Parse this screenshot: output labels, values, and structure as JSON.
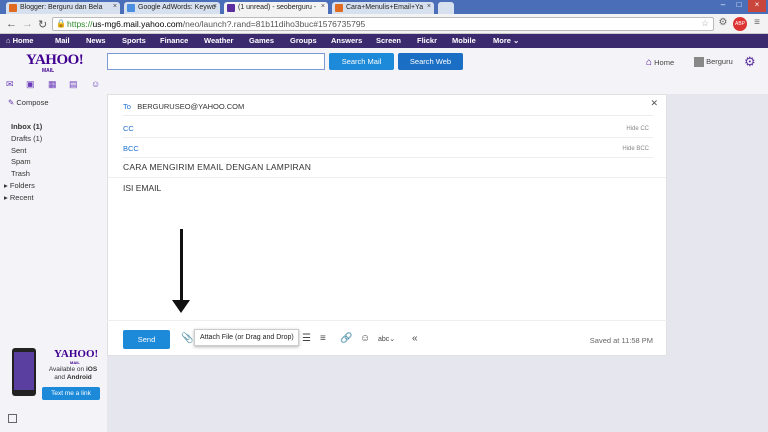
{
  "browser": {
    "tabs": [
      {
        "label": "Blogger: Berguru dan Bela",
        "fav_color": "#e06a1f",
        "active": false
      },
      {
        "label": "Google AdWords: Keywo",
        "fav_color": "#4a8fe0",
        "active": false
      },
      {
        "label": "(1 unread) - seoberguru -",
        "fav_color": "#5b2ea0",
        "active": true
      },
      {
        "label": "Cara+Menulis+Email+Ya",
        "fav_color": "#e06a1f",
        "active": false
      }
    ],
    "url_https": "https://",
    "url_domain": "us-mg6.mail.yahoo.com",
    "url_path": "/neo/launch?.rand=81b11diho3buc#1576735795"
  },
  "yahoo_nav": [
    "Home",
    "Mail",
    "News",
    "Sports",
    "Finance",
    "Weather",
    "Games",
    "Groups",
    "Answers",
    "Screen",
    "Flickr",
    "Mobile",
    "More"
  ],
  "header": {
    "logo": "YAHOO!",
    "logo_sub": "MAIL",
    "search_mail_label": "Search Mail",
    "search_web_label": "Search Web",
    "home_label": "Home",
    "user_label": "Berguru"
  },
  "sidebar": {
    "compose_label": "Compose",
    "folders": [
      {
        "label": "Inbox (1)",
        "bold": true
      },
      {
        "label": "Drafts (1)",
        "bold": false
      },
      {
        "label": "Sent",
        "bold": false
      },
      {
        "label": "Spam",
        "bold": false
      },
      {
        "label": "Trash",
        "bold": false
      },
      {
        "label": "Folders",
        "bold": false
      },
      {
        "label": "Recent",
        "bold": false
      }
    ],
    "promo": {
      "logo": "YAHOO!",
      "logo_sub": "MAIL",
      "text_pre": "Available on ",
      "text_ios": "iOS",
      "text_and": " and ",
      "text_android": "Android",
      "button_label": "Text me a link"
    }
  },
  "compose": {
    "to_label": "To",
    "to_value": "BERGURUSEO@YAHOO.COM",
    "cc_label": "CC",
    "hide_cc": "Hide CC",
    "bcc_label": "BCC",
    "hide_bcc": "Hide BCC",
    "subject": "CARA MENGIRIM EMAIL DENGAN LAMPIRAN",
    "body": "ISI EMAIL",
    "send_label": "Send",
    "attach_tooltip": "Attach File (or Drag and Drop)",
    "saved_status": "Saved at 11:58 PM"
  }
}
